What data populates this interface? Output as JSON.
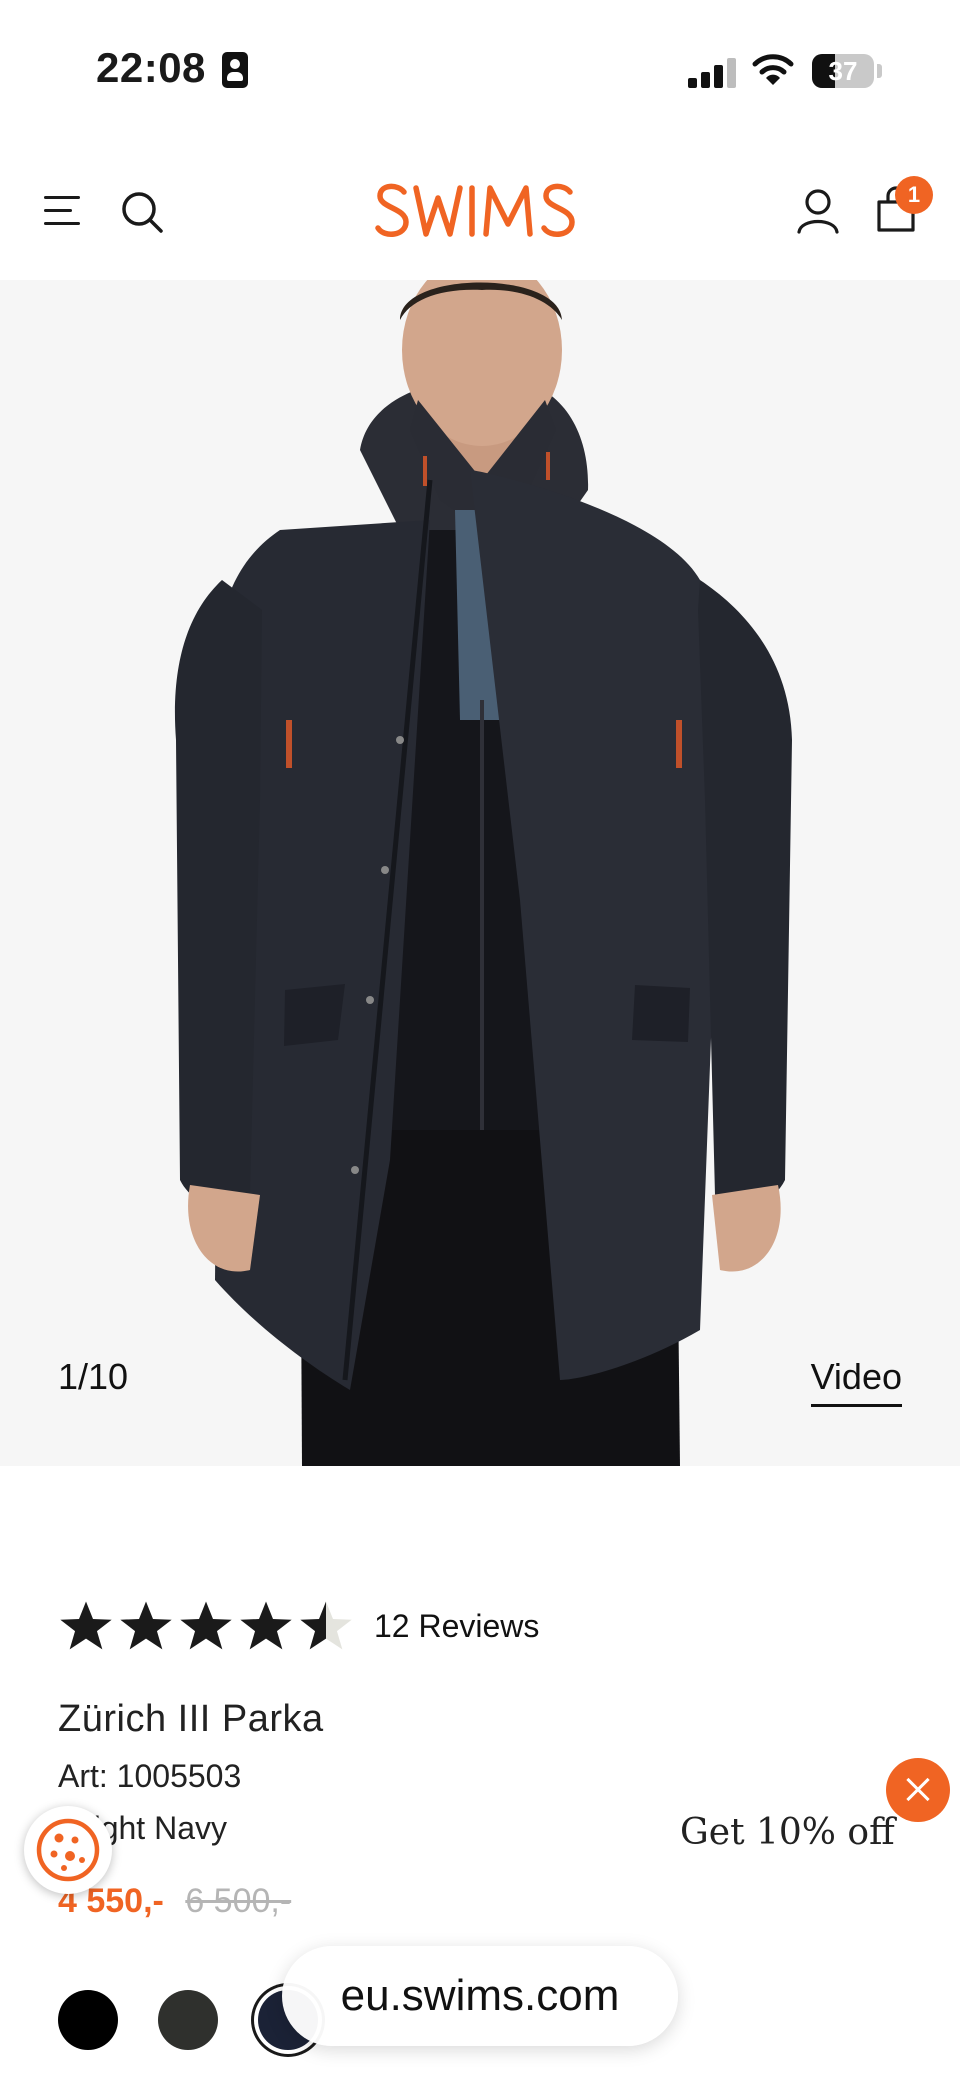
{
  "status_bar": {
    "time": "22:08",
    "battery_percent": "37",
    "battery_level": 0.37
  },
  "header": {
    "logo": "SWIMS",
    "cart_count": "1",
    "brand_color": "#f06423"
  },
  "gallery": {
    "counter": "1/10",
    "video_label": "Video"
  },
  "product": {
    "rating": 4.5,
    "reviews_label": "12 Reviews",
    "title": "Zürich III Parka",
    "article": "Art: 1005503",
    "color_name": "dnight Navy",
    "price": "4 550,-",
    "original_price": "6 500,-",
    "swatches": [
      {
        "color": "#000000"
      },
      {
        "color": "#2f302d"
      },
      {
        "color": "#1b2236",
        "selected": true
      }
    ]
  },
  "promo": {
    "label": "Get 10% off"
  },
  "browser": {
    "url": "eu.swims.com"
  }
}
